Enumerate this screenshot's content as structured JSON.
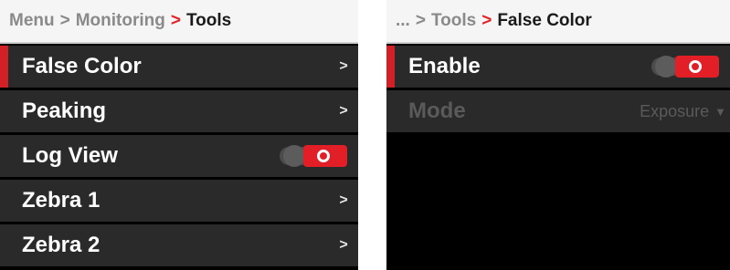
{
  "left_screen": {
    "breadcrumb": {
      "root": "Menu",
      "sep": ">",
      "middle": "Monitoring",
      "current": "Tools"
    },
    "items": [
      {
        "label": "False Color",
        "control": "chevron",
        "selected": true
      },
      {
        "label": "Peaking",
        "control": "chevron"
      },
      {
        "label": "Log View",
        "control": "toggle",
        "state": "on"
      },
      {
        "label": "Zebra 1",
        "control": "chevron"
      },
      {
        "label": "Zebra 2",
        "control": "chevron"
      }
    ]
  },
  "right_screen": {
    "breadcrumb": {
      "root": "...",
      "sep": ">",
      "middle": "Tools",
      "current": "False Color"
    },
    "items": [
      {
        "label": "Enable",
        "control": "toggle",
        "state": "on",
        "selected": true
      },
      {
        "label": "Mode",
        "control": "select",
        "value": "Exposure",
        "disabled": true
      }
    ]
  },
  "colors": {
    "accent": "#e21f26",
    "row_bg": "#2a2a2a",
    "screen_bg": "#000000",
    "crumb_bg": "#f5f5f5"
  }
}
